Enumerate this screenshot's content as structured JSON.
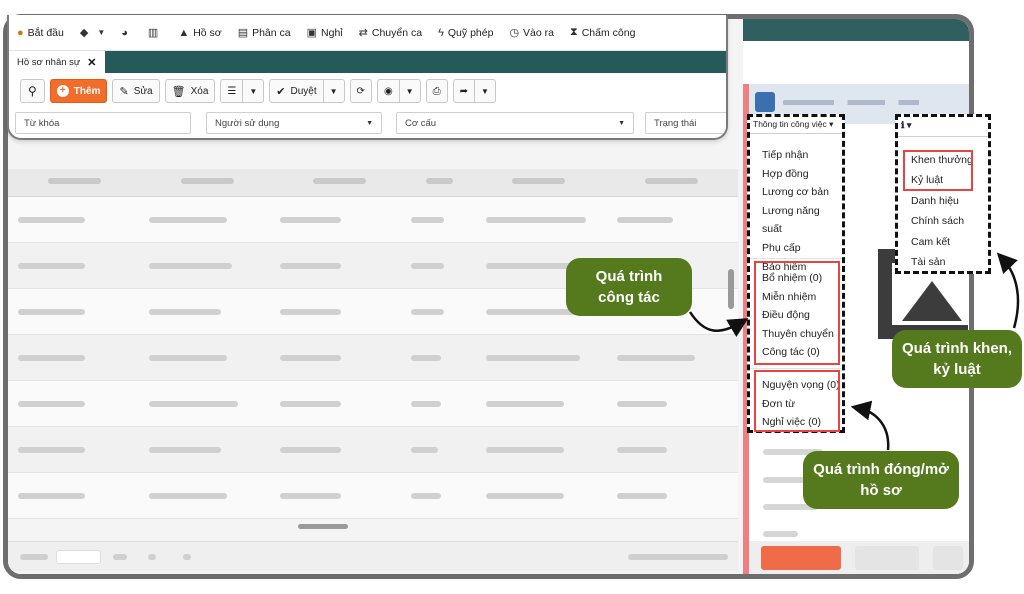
{
  "menubar": {
    "items": [
      {
        "label": "Bắt đầu",
        "icon": "start-icon"
      },
      {
        "label": "",
        "icon": "cube-icon"
      },
      {
        "label": "",
        "icon": "gauge-icon"
      },
      {
        "label": "",
        "icon": "report-icon"
      },
      {
        "label": "Hồ sơ",
        "icon": "user-icon"
      },
      {
        "label": "Phân ca",
        "icon": "schedule-icon"
      },
      {
        "label": "Nghỉ",
        "icon": "leave-icon"
      },
      {
        "label": "Chuyển ca",
        "icon": "exchange-icon"
      },
      {
        "label": "Quỹ phép",
        "icon": "fund-icon"
      },
      {
        "label": "Vào ra",
        "icon": "clock-icon"
      },
      {
        "label": "Chấm công",
        "icon": "hourglass-icon"
      }
    ]
  },
  "tabstrip": {
    "active_tab": "Hồ sơ nhân sự"
  },
  "toolbar": {
    "add_label": "Thêm",
    "edit_label": "Sửa",
    "delete_label": "Xóa",
    "approve_label": "Duyệt"
  },
  "filters": {
    "keyword_placeholder": "Từ khóa",
    "user_placeholder": "Người sử dụng",
    "structure_placeholder": "Cơ cấu",
    "status_placeholder": "Trạng thái"
  },
  "work_menu": {
    "trigger": "Thông tin công việc ▾",
    "group1": [
      "Tiếp nhận",
      "Hợp đồng",
      "Lương cơ bản",
      "Lương năng suất",
      "Phụ cấp",
      "Bảo hiểm"
    ],
    "group2": [
      "Bổ nhiệm (0)",
      "Miễn nhiệm",
      "Điều động",
      "Thuyên chuyển",
      "Công tác (0)"
    ],
    "group3": [
      "Nguyện vọng (0)",
      "Đơn từ",
      "Nghỉ việc (0)"
    ]
  },
  "reward_menu": {
    "trigger": "ℹ ▾",
    "items": [
      "Khen thưởng",
      "Kỷ luật",
      "Danh hiệu",
      "Chính sách",
      "Cam kết",
      "Tài sản"
    ]
  },
  "callouts": {
    "work_process": "Quá trình công tác",
    "reward_discipline": "Quá trình khen, kỷ luật",
    "record_open_close": "Quá trình đóng/mở hồ sơ"
  },
  "colors": {
    "brand_orange": "#f26c2a",
    "teal_bar": "#245a5a",
    "callout_green": "#557a1d",
    "highlight_red": "#e74444"
  }
}
